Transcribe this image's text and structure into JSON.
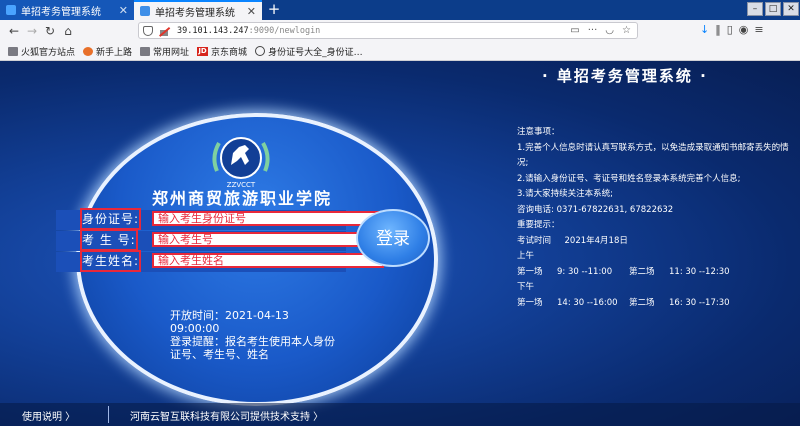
{
  "browser": {
    "tabs": [
      {
        "title": "单招考务管理系统",
        "close": "✕",
        "active": false
      },
      {
        "title": "单招考务管理系统",
        "close": "✕",
        "active": true
      }
    ],
    "new_tab": "+",
    "url_host": "39.101.143.247",
    "url_rest": ":9090/newlogin",
    "bookmarks": [
      "火狐官方站点",
      "新手上路",
      "常用网址",
      "京东商城",
      "身份证号大全_身份证…"
    ],
    "jd_icon_text": "JD"
  },
  "page": {
    "system_title": "· 单招考务管理系统 ·",
    "school_name": "郑州商贸旅游职业学院",
    "logo_text": "ZZVCCT",
    "form": {
      "id_label": "身份证号:",
      "id_placeholder": "输入考生身份证号",
      "exam_label": "考 生 号:",
      "exam_placeholder": "输入考生号",
      "name_label": "考生姓名:",
      "name_placeholder": "输入考生姓名"
    },
    "login_button": "登录",
    "open_time": "开放时间：2021-04-13 09:00:00",
    "login_tip": "登录提醒：报名考生使用本人身份证号、考生号、姓名",
    "notice": {
      "heading": "注意事项：",
      "item1": "1.完善个人信息时请认真写联系方式，以免造成录取通知书邮寄丢失的情况;",
      "item2": "2.请输入身份证号、考证号和姓名登录本系统完善个人信息;",
      "item3": "3.请大家持续关注本系统;",
      "phone": "咨询电话: 0371-67822631, 67822632",
      "important": "重要提示：",
      "exam_time": "考试时间     2021年4月18日",
      "morning": "上午",
      "morning_sched": [
        {
          "label": "第一场",
          "time": "9: 30 --11:00"
        },
        {
          "label": "第二场",
          "time": "11: 30 --12:30"
        }
      ],
      "afternoon": "下午",
      "afternoon_sched": [
        {
          "label": "第一场",
          "time": "14: 30 --16:00"
        },
        {
          "label": "第二场",
          "time": "16: 30 --17:30"
        }
      ]
    },
    "footer": {
      "help": "使用说明 〉",
      "support": "河南云智互联科技有限公司提供技术支持 〉"
    }
  },
  "colors": {
    "accent_red": "#e8283a",
    "page_blue": "#1a5ac9"
  }
}
